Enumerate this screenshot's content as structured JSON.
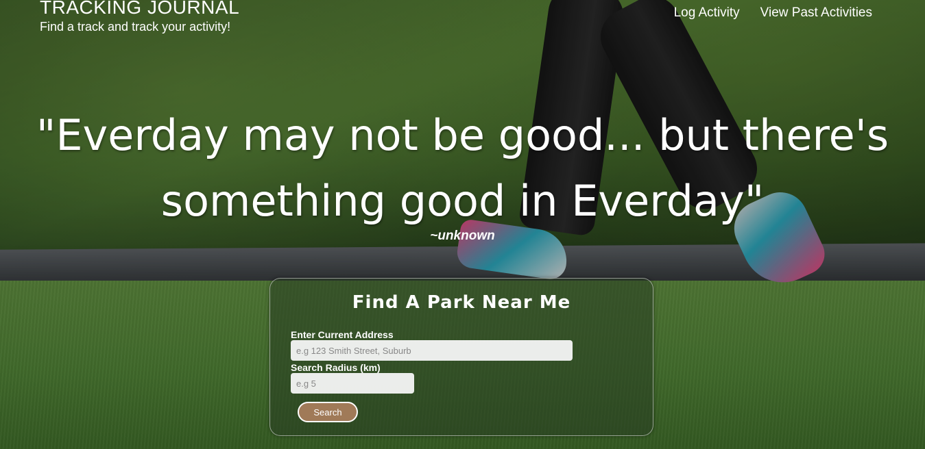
{
  "header": {
    "title": "TRACKING JOURNAL",
    "subtitle": "Find a track and track your activity!",
    "nav": [
      {
        "label": "Log Activity"
      },
      {
        "label": "View Past Activities"
      }
    ]
  },
  "hero": {
    "quote": "\"Everday may not be good... but there's something good in Everday\"",
    "author": "~unknown"
  },
  "finder": {
    "title": "Find A Park Near Me",
    "address_label": "Enter Current Address",
    "address_placeholder": "e.g 123 Smith Street, Suburb",
    "address_value": "",
    "radius_label": "Search Radius (km)",
    "radius_placeholder": "e.g 5",
    "radius_value": "",
    "search_label": "Search"
  },
  "colors": {
    "button_bg": "#a07a58",
    "text": "#ffffff"
  }
}
